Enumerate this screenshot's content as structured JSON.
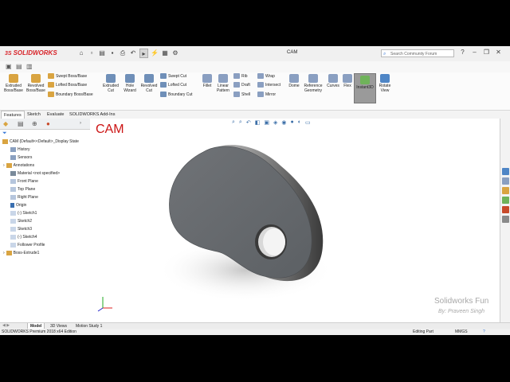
{
  "app": {
    "brand": "SOLIDWORKS",
    "document_title": "CAM",
    "search_placeholder": "Search Community Forum"
  },
  "ribbon": {
    "big_buttons": [
      {
        "label": "Extruded Boss/Base",
        "color": "#d9a441"
      },
      {
        "label": "Revolved Boss/Base",
        "color": "#d9a441"
      },
      {
        "label": "Extruded Cut",
        "color": "#6f8fb8"
      },
      {
        "label": "Hole Wizard",
        "color": "#6f8fb8"
      },
      {
        "label": "Revolved Cut",
        "color": "#6f8fb8"
      },
      {
        "label": "Fillet",
        "color": "#8a9fc1"
      },
      {
        "label": "Linear Pattern",
        "color": "#8a9fc1"
      },
      {
        "label": "Dome",
        "color": "#8a9fc1"
      },
      {
        "label": "Reference Geometry",
        "color": "#8a9fc1"
      },
      {
        "label": "Curves",
        "color": "#8a9fc1"
      },
      {
        "label": "Flex",
        "color": "#8a9fc1"
      },
      {
        "label": "Instant3D",
        "color": "#6fb35a"
      },
      {
        "label": "Rotate View",
        "color": "#4f86c6"
      }
    ],
    "small_boss": [
      "Swept Boss/Base",
      "Lofted Boss/Base",
      "Boundary Boss/Base"
    ],
    "small_cut": [
      "Swept Cut",
      "Lofted Cut",
      "Boundary Cut"
    ],
    "small_feat": [
      "Rib",
      "Draft",
      "Shell"
    ],
    "small_feat2": [
      "Wrap",
      "Intersect",
      "Mirror"
    ]
  },
  "command_tabs": [
    "Features",
    "Sketch",
    "Evaluate",
    "SOLIDWORKS Add-Ins"
  ],
  "tree": {
    "root": "CAM (Default<<Default>_Display State",
    "items": [
      "History",
      "Sensors",
      "Annotations",
      "Material <not specified>",
      "Front Plane",
      "Top Plane",
      "Right Plane",
      "Origin",
      "(-) Sketch1",
      "Sketch2",
      "Sketch3",
      "(-) Sketch4",
      "Follower Profile",
      "Boss-Extrude1"
    ]
  },
  "viewport": {
    "part_label": "CAM",
    "watermark_title": "Solidworks Fun",
    "watermark_author": "By: Praveen Singh"
  },
  "bottom_tabs": [
    "Model",
    "3D Views",
    "Motion Study 1"
  ],
  "status": {
    "edition": "SOLIDWORKS Premium 2018 x64 Edition",
    "mode": "Editing Part",
    "units": "MMGS"
  }
}
